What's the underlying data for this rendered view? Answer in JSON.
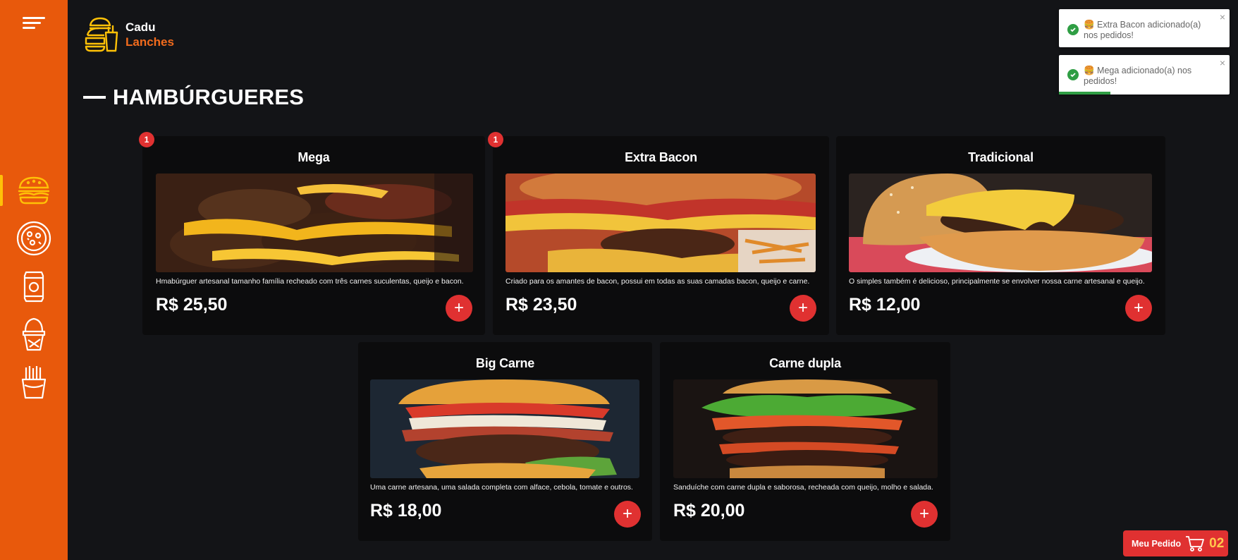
{
  "brand": {
    "line1": "Cadu",
    "line2": "Lanches",
    "accent": "#e8590c"
  },
  "sidebar": {
    "menu_icon": "hamburger-menu-icon",
    "categories": [
      {
        "name": "burger-icon",
        "active": true
      },
      {
        "name": "pizza-icon",
        "active": false
      },
      {
        "name": "soda-can-icon",
        "active": false
      },
      {
        "name": "ice-cream-icon",
        "active": false
      },
      {
        "name": "fries-icon",
        "active": false
      }
    ]
  },
  "section": {
    "title": "HAMBÚRGUERES"
  },
  "products": [
    {
      "name": "Mega",
      "description": "Hmabúrguer artesanal tamanho família recheado com três carnes suculentas, queijo e bacon.",
      "price": "R$ 25,50",
      "qty_badge": "1",
      "add_label": "+"
    },
    {
      "name": "Extra Bacon",
      "description": "Criado para os amantes de bacon, possui em todas as suas camadas bacon, queijo e carne.",
      "price": "R$ 23,50",
      "qty_badge": "1",
      "add_label": "+"
    },
    {
      "name": "Tradicional",
      "description": "O simples também é delicioso, principalmente se envolver nossa carne artesanal e queijo.",
      "price": "R$ 12,00",
      "qty_badge": "",
      "add_label": "+"
    },
    {
      "name": "Big Carne",
      "description": "Uma carne artesana, uma salada completa com alface, cebola, tomate e outros.",
      "price": "R$ 18,00",
      "qty_badge": "",
      "add_label": "+"
    },
    {
      "name": "Carne dupla",
      "description": "Sanduíche com carne dupla e saborosa, recheada com queijo, molho e salada.",
      "price": "R$ 20,00",
      "qty_badge": "",
      "add_label": "+"
    }
  ],
  "toasts": [
    {
      "message": "🍔 Extra Bacon adicionado(a) nos pedidos!",
      "close": "×"
    },
    {
      "message": "🍔 Mega adicionado(a) nos pedidos!",
      "close": "×",
      "progress": 0.3
    }
  ],
  "cart": {
    "label": "Meu Pedido",
    "count": "02",
    "icon": "cart-icon"
  }
}
